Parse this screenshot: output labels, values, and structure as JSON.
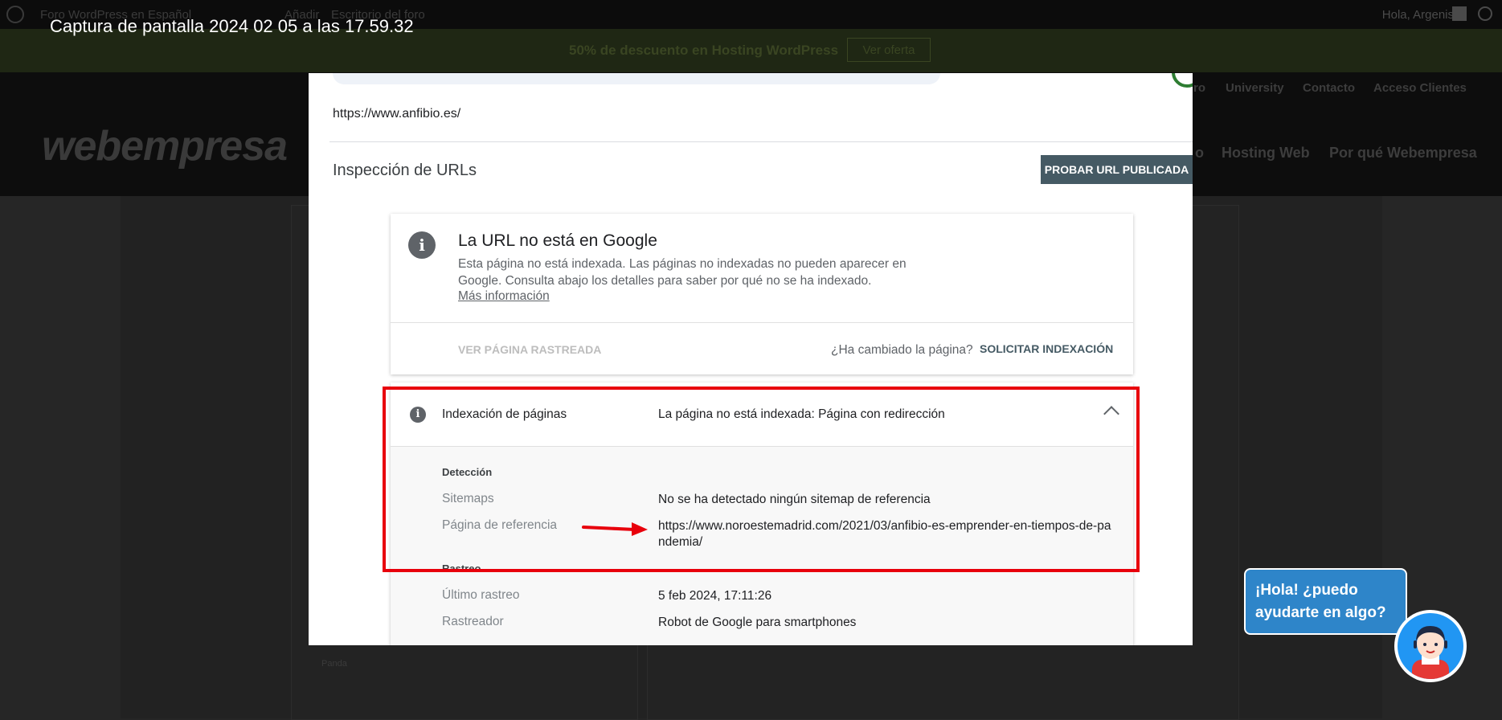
{
  "caption": "Captura de pantalla 2024 02 05 a las 17.59.32",
  "background_site": {
    "adminbar": {
      "forum": "Foro WordPress en Español",
      "add": "Añadir",
      "desk": "Escritorio del foro",
      "greeting": "Hola, Argenis"
    },
    "promo": {
      "text": "50% de descuento en Hosting WordPress",
      "button": "Ver oferta"
    },
    "logo": "webempresa",
    "top_nav": [
      "ro",
      "University",
      "Contacto",
      "Acceso Clientes"
    ],
    "main_nav": [
      "o",
      "Hosting Web",
      "Por qué Webempresa"
    ],
    "bottom_snippet": "Panda"
  },
  "gsc": {
    "url": "https://www.anfibio.es/",
    "inspection_title": "Inspección de URLs",
    "test_live_button": "PROBAR URL PUBLICADA",
    "status_card": {
      "title": "La URL no está en Google",
      "description": "Esta página no está indexada. Las páginas no indexadas no pueden aparecer en Google. Consulta abajo los detalles para saber por qué no se ha indexado.",
      "more_link": "Más información",
      "view_crawled": "VER PÁGINA RASTREADA",
      "changed_question": "¿Ha cambiado la página?",
      "request_indexing": "SOLICITAR INDEXACIÓN"
    },
    "indexing_card": {
      "label": "Indexación de páginas",
      "value": "La página no está indexada: Página con redirección",
      "detection_heading": "Detección",
      "sitemaps_label": "Sitemaps",
      "sitemaps_value": "No se ha detectado ningún sitemap de referencia",
      "referrer_label": "Página de referencia",
      "referrer_value": "https://www.noroestemadrid.com/2021/03/anfibio-es-emprender-en-tiempos-de-pandemia/",
      "crawl_heading": "Rastreo",
      "last_crawl_label": "Último rastreo",
      "last_crawl_value": "5 feb 2024, 17:11:26",
      "crawler_label": "Rastreador",
      "crawler_value": "Robot de Google para smartphones"
    }
  },
  "chat": {
    "message": "¡Hola! ¿puedo ayudarte en algo?"
  },
  "colors": {
    "highlight_box": "#e8000c",
    "chat_blue": "#2e85c9",
    "button_slate": "#455a64"
  }
}
